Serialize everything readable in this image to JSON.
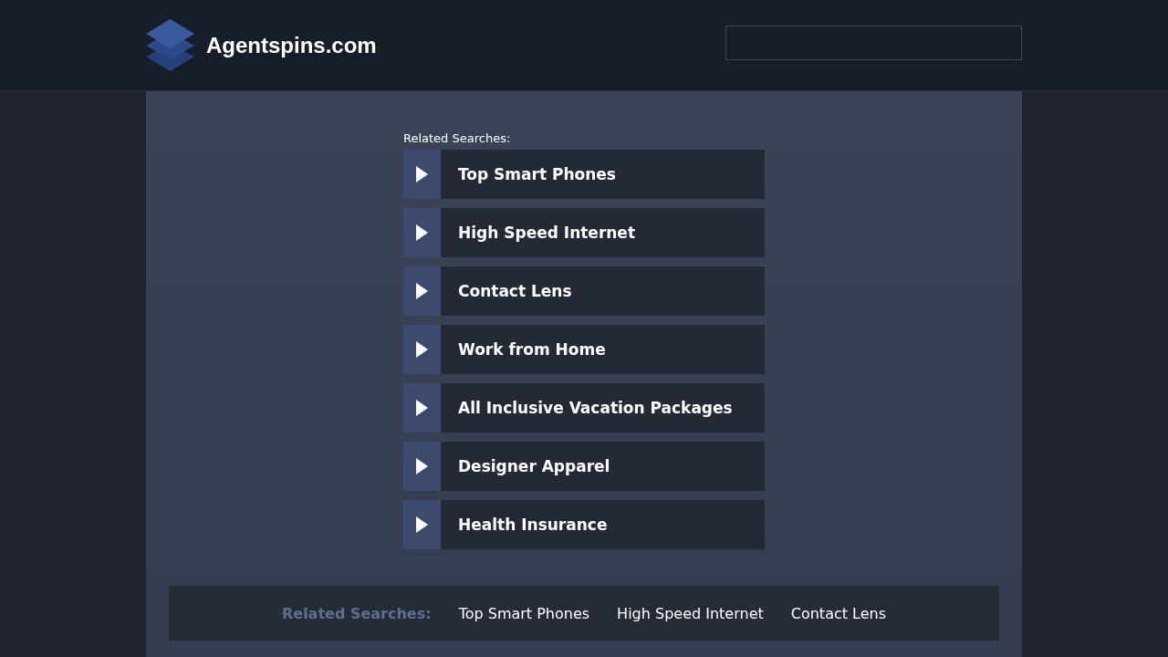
{
  "header": {
    "site_name": "Agentspins.com"
  },
  "related": {
    "heading": "Related Searches:",
    "items": [
      {
        "label": "Top Smart Phones"
      },
      {
        "label": "High Speed Internet"
      },
      {
        "label": "Contact Lens"
      },
      {
        "label": "Work from Home"
      },
      {
        "label": "All Inclusive Vacation Packages"
      },
      {
        "label": "Designer Apparel"
      },
      {
        "label": "Health Insurance"
      }
    ]
  },
  "footer": {
    "heading": "Related Searches:",
    "links": [
      "Top Smart Phones",
      "High Speed Internet",
      "Contact Lens"
    ]
  }
}
